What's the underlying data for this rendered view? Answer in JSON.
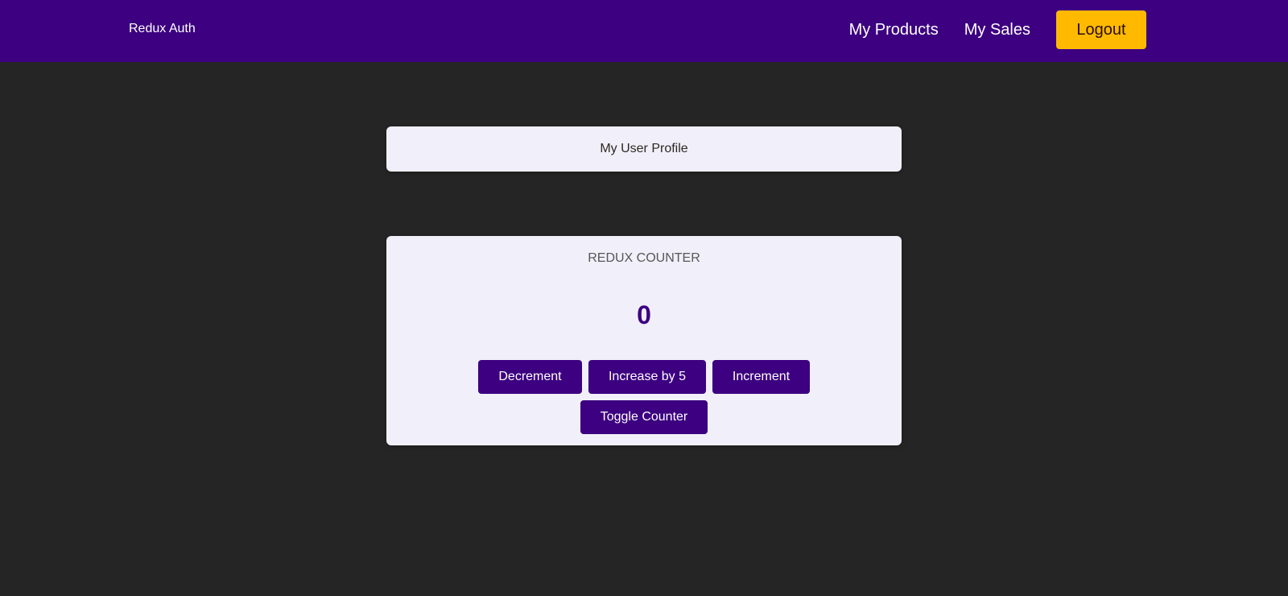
{
  "header": {
    "brand": "Redux Auth",
    "nav": {
      "products_label": "My Products",
      "sales_label": "My Sales"
    },
    "logout_label": "Logout"
  },
  "profile": {
    "title": "My User Profile"
  },
  "counter": {
    "title": "Redux Counter",
    "value": "0",
    "buttons": {
      "decrement": "Decrement",
      "increase_by_5": "Increase by 5",
      "increment": "Increment",
      "toggle": "Toggle Counter"
    }
  },
  "colors": {
    "header_bg": "#3c0080",
    "page_bg": "#252525",
    "card_bg": "#f1eff9",
    "accent_button": "#ffba00",
    "primary_button": "#3c0080"
  }
}
